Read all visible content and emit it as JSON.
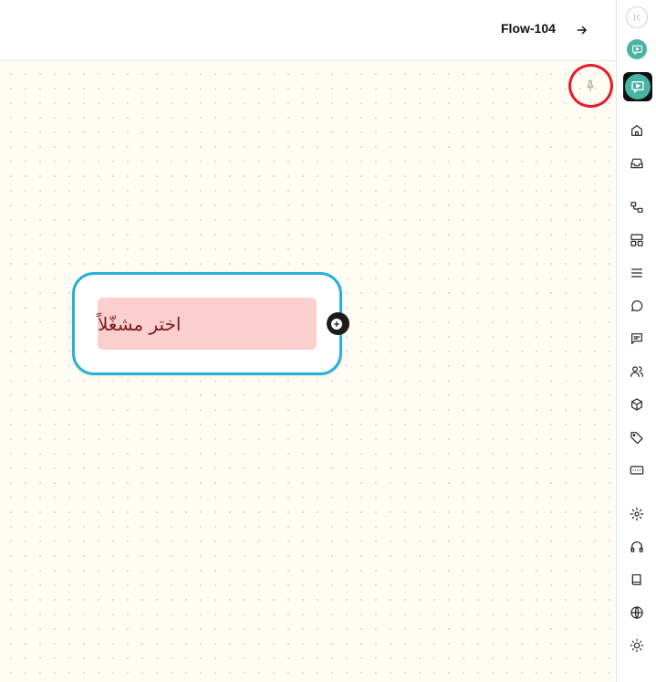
{
  "header": {
    "flow_title": "Flow-104",
    "arrow_icon": "arrow-right-icon"
  },
  "canvas": {
    "pin_icon": "pin-icon",
    "node": {
      "label": "اختر مشغّلاً",
      "label_bg": "#fccfcf",
      "border_color": "#28afd7",
      "handle_icon": "plus-circle-icon"
    },
    "highlight_color": "#e41c2c"
  },
  "sidebar": {
    "collapse_icon": "collapse-left-icon",
    "app_icon": "chat-app-icon",
    "accent": "#4ab4a3",
    "items": [
      "home-icon",
      "inbox-icon",
      "flows-icon",
      "layout-icon",
      "list-icon",
      "chat-bubble-icon",
      "message-square-icon",
      "users-icon",
      "package-icon",
      "tag-icon",
      "keyboard-icon",
      "settings-icon",
      "headphones-icon",
      "book-icon",
      "globe-icon",
      "sun-icon"
    ]
  }
}
